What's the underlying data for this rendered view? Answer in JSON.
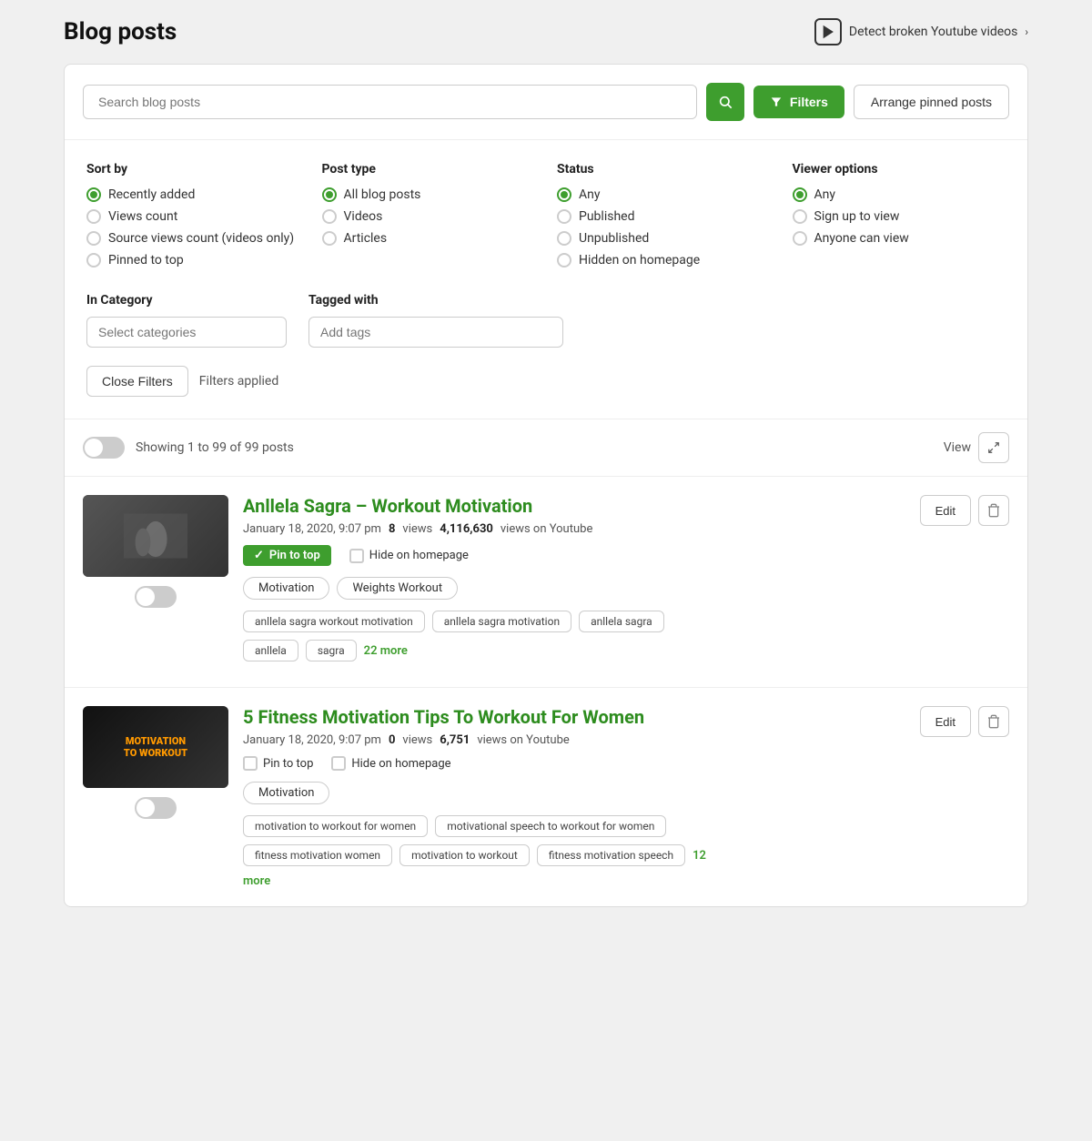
{
  "page": {
    "title": "Blog posts",
    "detect_link": "Detect broken Youtube videos"
  },
  "search": {
    "placeholder": "Search blog posts"
  },
  "buttons": {
    "filters": "Filters",
    "arrange": "Arrange pinned posts",
    "close_filters": "Close Filters",
    "filters_applied": "Filters applied",
    "view": "View",
    "edit": "Edit"
  },
  "sort_by": {
    "label": "Sort by",
    "options": [
      {
        "label": "Recently added",
        "selected": true
      },
      {
        "label": "Views count",
        "selected": false
      },
      {
        "label": "Source views count (videos only)",
        "selected": false
      },
      {
        "label": "Pinned to top",
        "selected": false
      }
    ]
  },
  "post_type": {
    "label": "Post type",
    "options": [
      {
        "label": "All blog posts",
        "selected": true
      },
      {
        "label": "Videos",
        "selected": false
      },
      {
        "label": "Articles",
        "selected": false
      }
    ]
  },
  "status": {
    "label": "Status",
    "options": [
      {
        "label": "Any",
        "selected": true
      },
      {
        "label": "Published",
        "selected": false
      },
      {
        "label": "Unpublished",
        "selected": false
      },
      {
        "label": "Hidden on homepage",
        "selected": false
      }
    ]
  },
  "viewer_options": {
    "label": "Viewer options",
    "options": [
      {
        "label": "Any",
        "selected": true
      },
      {
        "label": "Sign up to view",
        "selected": false
      },
      {
        "label": "Anyone can view",
        "selected": false
      }
    ]
  },
  "in_category": {
    "label": "In Category",
    "placeholder": "Select categories"
  },
  "tagged_with": {
    "label": "Tagged with",
    "placeholder": "Add tags"
  },
  "results": {
    "showing": "Showing 1 to 99 of 99 posts"
  },
  "posts": [
    {
      "id": 1,
      "title": "Anllela Sagra – Workout Motivation",
      "date": "January 18, 2020, 9:07 pm",
      "views": "8",
      "views_label": "views",
      "youtube_views": "4,116,630",
      "youtube_label": "views on Youtube",
      "pinned": true,
      "hide_on_homepage": false,
      "categories": [
        "Motivation",
        "Weights Workout"
      ],
      "seo_tags": [
        "anllela sagra workout motivation",
        "anllela sagra motivation",
        "anllela sagra",
        "anllela",
        "sagra"
      ],
      "more_count": "22 more",
      "thumb_type": "workout"
    },
    {
      "id": 2,
      "title": "5 Fitness Motivation Tips To Workout For Women",
      "date": "January 18, 2020, 9:07 pm",
      "views": "0",
      "views_label": "views",
      "youtube_views": "6,751",
      "youtube_label": "views on Youtube",
      "pinned": false,
      "hide_on_homepage": false,
      "categories": [
        "Motivation"
      ],
      "seo_tags": [
        "motivation to workout for women",
        "motivational speech to workout for women",
        "fitness motivation women",
        "motivation to workout",
        "fitness motivation speech"
      ],
      "more_count": "12",
      "more_label": "more",
      "thumb_type": "fitness"
    }
  ]
}
